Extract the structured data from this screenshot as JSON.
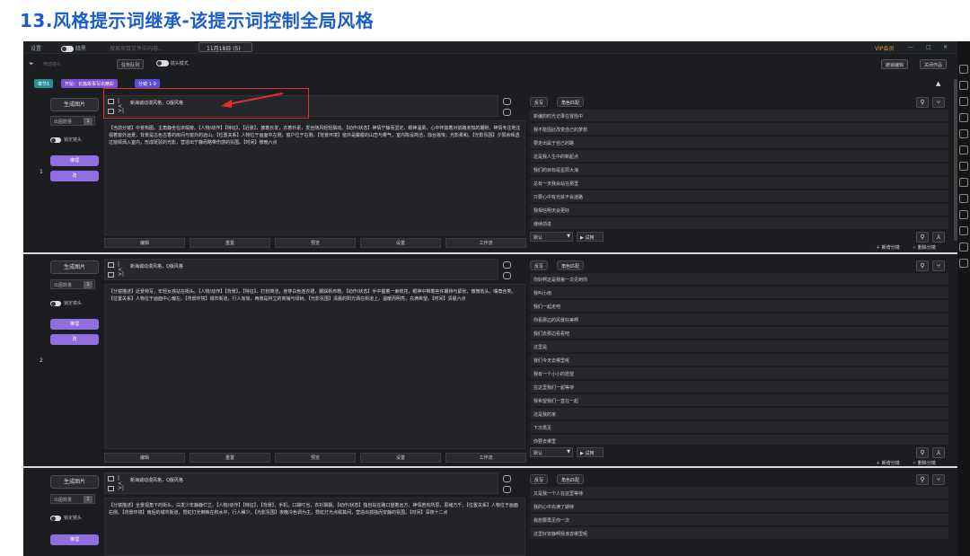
{
  "heading": "13.风格提示词继承-该提示词控制全局风格",
  "topbar": {
    "app_name": "设置",
    "toggle_label": "暗黑",
    "search_placeholder": "搜索项目文件中内容...",
    "date": "11月18日 (5)",
    "vip": "VIP会员"
  },
  "toolbar": {
    "filter_placeholder": "筛选镜头",
    "tasklist": "任务队列",
    "mode_label": "镜头模式",
    "restore": "撤销编辑",
    "close_project": "关闭作品"
  },
  "tags": [
    {
      "label": "章节1",
      "color": "#2c8f8f"
    },
    {
      "label": "开始：长篇故事写出精彩",
      "color": "#7a4fd0"
    },
    {
      "label": "分镜 1-9",
      "color": "#5b4fd0"
    }
  ],
  "common": {
    "generate": "生成图片",
    "count_label": "出图数量",
    "count_value": "1",
    "lock": "锁定镜头",
    "btn_a": "推理",
    "btn_b": "改",
    "reverse": "反写",
    "role_match": "角色匹配",
    "default": "默认",
    "try": "试用",
    "new_shot": "新增分镜",
    "delete_shot": "删除分镜",
    "bottom": [
      "编辑",
      "重置",
      "预览",
      "设置",
      "工作流"
    ]
  },
  "rows": [
    {
      "num": "1",
      "prompt": "新海诚动漫风格，Q版风格",
      "desc": "【当前分镜】中景构图，主角静坐在床榻旁。【人物/动作】【特征】，【近景】，披着长发，衣着朴素，发丝随风轻轻飘动。【动作/状态】神情宁静而坚定，眼神温柔，心中怀揣着对前路未知的期盼，神情专注地注视着窗外远景，背景是古色古香的房间与窗外的远山。【位置关系】人物位于画面中左侧，窗户位于右侧。【背景环境】窗外是朦胧的山峦与雾气，室内陈设简洁，烛台摇曳，光影柔和。【光影氛围】夕阳余晖透过窗棂洒入室内，形成斑驳的光影，营造出宁静而略带伤感的氛围。【时间】傍晚六点",
      "shots": [
        "新编的时光记录在冒险中",
        "我不能因此改变自己的梦想",
        "要走出属于自己的路",
        "这是我人生中的新起点",
        "我们的目标是星辰大海",
        "总有一天我会站在那里",
        "只要心中有光就不会迷路",
        "我相信明天会更好",
        "继续前进"
      ]
    },
    {
      "num": "2",
      "prompt": "新海诚动漫风格，Q版风格",
      "desc": "【分镜描述】近景特写，年轻女孩站在街头。【人物/动作】【背景】，【特征】，打扮简洁，身穿白色连衣裙，脚踩帆布鞋。【动作/状态】手中握着一束鲜花，眼神中带着些许期待与紧张，微微低头，嘴角含笑。【位置关系】人物位于画面中心偏左。【背景环境】城市街道，行人匆匆，两旁是林立的商铺与绿树。【光影氛围】清晨的阳光洒在街道上，温暖而明亮，充满希望。【时间】清晨六点",
      "shots": [
        "你好啊这是我第一次见到你",
        "我叫小雨",
        "我们一起走吧",
        "你看那边的风景好美啊",
        "我们去那边看看吧",
        "这里是",
        "我们今天去哪里呢",
        "我有一个小小的愿望",
        "在这里我们一起等待",
        "我希望我们一直在一起",
        "这是我的家",
        "下次再见",
        "你要去哪里"
      ]
    },
    {
      "num": "3",
      "prompt": "新海诚动漫风格，Q版风格",
      "desc": "【分镜描述】全景视角下的街头，白发少年静静伫立。【人物/动作】【特征】，【背景】，手机，口袋叮当，衣衫飘飘。【动作/状态】独自站在路口望着远方，神情若有所思，思绪万千。【位置关系】人物位于画面右侧。【背景环境】雨后的城市街道，霓虹灯光倒映在积水中，行人稀少。【光影氛围】夜晚冷色调为主，霓虹灯光点缀其间，营造出孤独而安静的氛围。【时间】深夜十二点",
      "shots": [
        "又是我一个人在这里等待",
        "我的心中充满了期待",
        "我想要再见你一次",
        "这里好安静啊我该去哪里呢"
      ]
    }
  ]
}
